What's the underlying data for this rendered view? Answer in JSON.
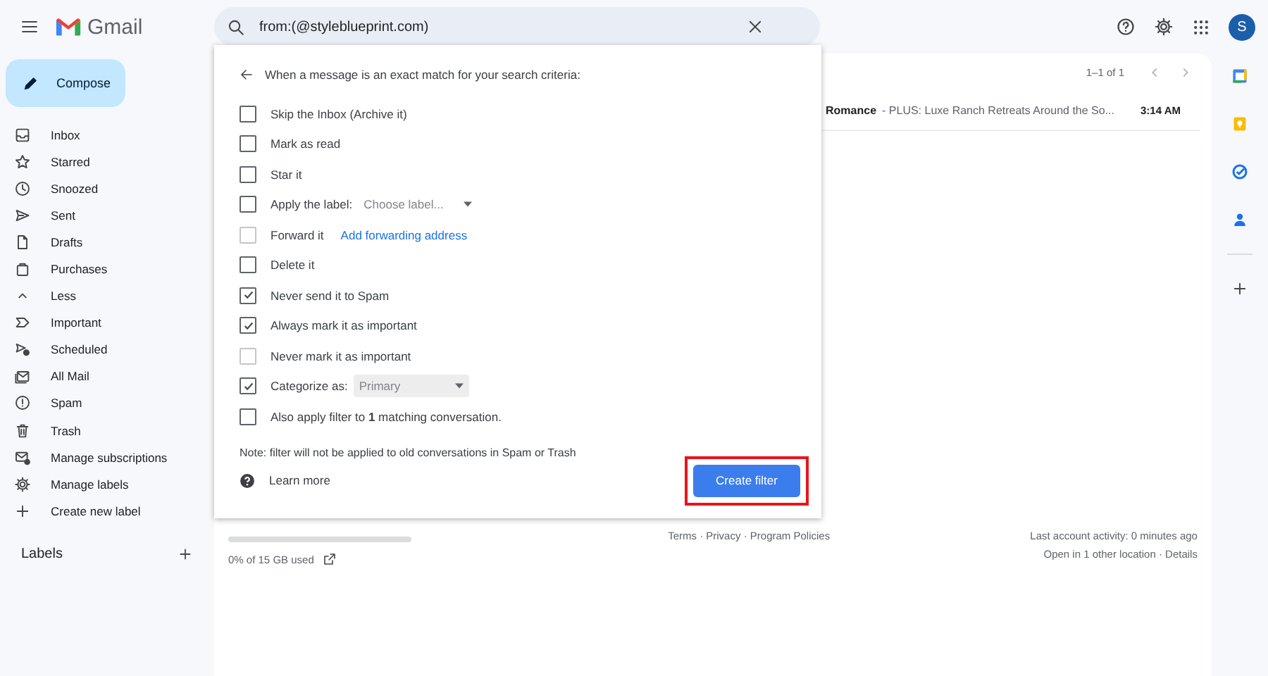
{
  "header": {
    "app_name": "Gmail",
    "search_value": "from:(@styleblueprint.com)",
    "avatar_letter": "S"
  },
  "compose": {
    "label": "Compose"
  },
  "sidebar": {
    "items": [
      {
        "label": "Inbox",
        "selected": false
      },
      {
        "label": "Starred",
        "selected": false
      },
      {
        "label": "Snoozed",
        "selected": false
      },
      {
        "label": "Sent",
        "selected": false
      },
      {
        "label": "Drafts",
        "selected": false
      },
      {
        "label": "Purchases",
        "selected": false
      },
      {
        "label": "Less",
        "selected": false
      },
      {
        "label": "Important",
        "selected": false
      },
      {
        "label": "Scheduled",
        "selected": false
      },
      {
        "label": "All Mail",
        "selected": false
      },
      {
        "label": "Spam",
        "selected": false
      },
      {
        "label": "Trash",
        "selected": false
      },
      {
        "label": "Manage subscriptions",
        "selected": false
      },
      {
        "label": "Manage labels",
        "selected": false
      },
      {
        "label": "Create new label",
        "selected": false
      }
    ],
    "labels_heading": "Labels"
  },
  "list": {
    "pagination": "1–1 of 1",
    "messages": [
      {
        "subject": "Romance",
        "snippet": "- PLUS: Luxe Ranch Retreats Around the So...",
        "time": "3:14 AM",
        "unread": true
      }
    ]
  },
  "footer": {
    "storage": "0% of 15 GB used",
    "storage_bar": {
      "level": 0
    },
    "links": "Terms · Privacy · Program Policies",
    "activity": "Last account activity: 0 minutes ago",
    "location": "Open in 1 other location · Details"
  },
  "filter": {
    "heading": "When a message is an exact match for your search criteria:",
    "options": [
      {
        "label": "Skip the Inbox (Archive it)",
        "checked": false,
        "disabled": false
      },
      {
        "label": "Mark as read",
        "checked": false,
        "disabled": false
      },
      {
        "label": "Star it",
        "checked": false,
        "disabled": false
      },
      {
        "label": "Apply the label:",
        "checked": false,
        "disabled": false,
        "extra": {
          "kind": "select",
          "value": "Choose label...",
          "filled": false
        }
      },
      {
        "label": "Forward it",
        "checked": false,
        "disabled": true,
        "extra": {
          "kind": "link",
          "value": "Add forwarding address"
        }
      },
      {
        "label": "Delete it",
        "checked": false,
        "disabled": false
      },
      {
        "label": "Never send it to Spam",
        "checked": true,
        "disabled": false
      },
      {
        "label": "Always mark it as important",
        "checked": true,
        "disabled": false
      },
      {
        "label": "Never mark it as important",
        "checked": false,
        "disabled": true
      },
      {
        "label": "Categorize as:",
        "checked": true,
        "disabled": false,
        "extra": {
          "kind": "select",
          "value": "Primary",
          "filled": true
        }
      },
      {
        "label": "Also apply filter to **1** matching conversation.",
        "checked": false,
        "disabled": false
      }
    ],
    "note": "Note: filter will not be applied to old conversations in Spam or Trash",
    "learn_more": "Learn more",
    "create_button": {
      "label": "Create filter",
      "highlighted": true
    }
  }
}
